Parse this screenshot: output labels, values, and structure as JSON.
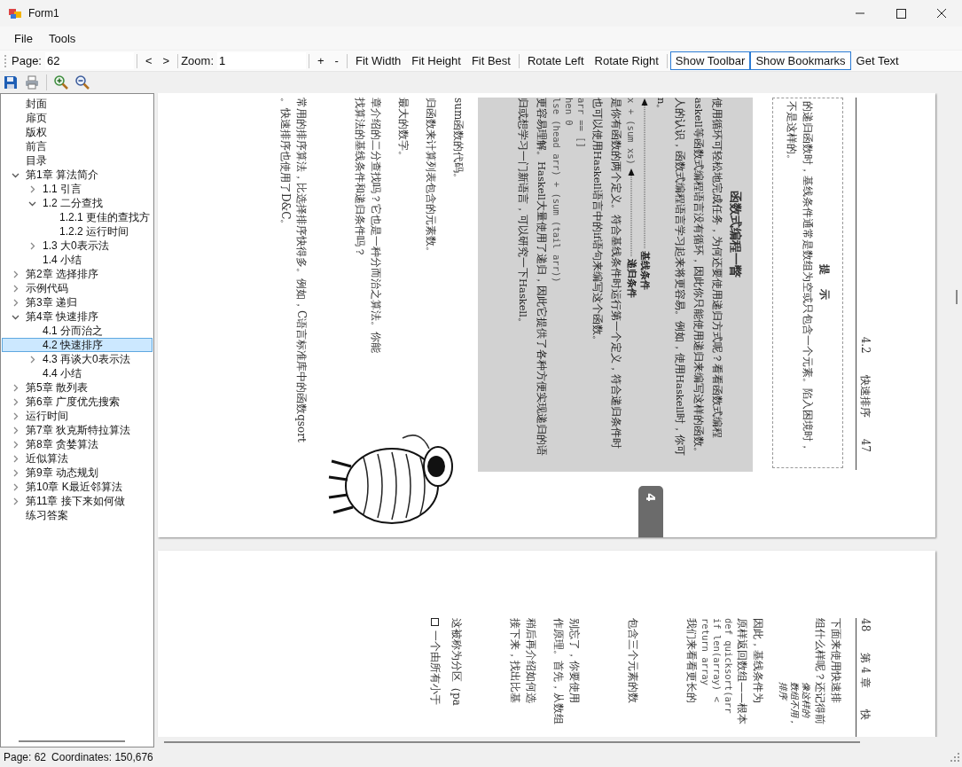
{
  "window": {
    "title": "Form1"
  },
  "menu": [
    "File",
    "Tools"
  ],
  "toolbar": {
    "groups": [
      [
        {
          "kind": "label",
          "text": "Page:"
        },
        {
          "kind": "field",
          "value": "62"
        }
      ],
      [
        {
          "kind": "button",
          "text": "<"
        },
        {
          "kind": "button",
          "text": ">"
        }
      ],
      [
        {
          "kind": "label",
          "text": "Zoom:"
        },
        {
          "kind": "field",
          "value": "1"
        }
      ],
      [
        {
          "kind": "button",
          "text": "+"
        },
        {
          "kind": "button",
          "text": "-"
        }
      ],
      [
        {
          "kind": "button",
          "text": "Fit Width"
        },
        {
          "kind": "button",
          "text": "Fit Height"
        },
        {
          "kind": "button",
          "text": "Fit Best"
        }
      ],
      [
        {
          "kind": "button",
          "text": "Rotate Left"
        },
        {
          "kind": "button",
          "text": "Rotate Right"
        }
      ],
      [
        {
          "kind": "toggle",
          "text": "Show Toolbar",
          "checked": true
        },
        {
          "kind": "toggle",
          "text": "Show Bookmarks",
          "checked": true
        },
        {
          "kind": "button",
          "text": "Get Text"
        }
      ]
    ]
  },
  "sidebar": {
    "items": [
      {
        "label": "封面",
        "selected": false
      },
      {
        "label": "扉页",
        "selected": false
      },
      {
        "label": "版权",
        "selected": false
      },
      {
        "label": "前言",
        "selected": false
      },
      {
        "label": "目录",
        "selected": false
      },
      {
        "label": "第1章 算法简介",
        "selected": false,
        "expanded": true,
        "children": [
          {
            "label": "1.1 引言",
            "selected": false,
            "expanded": false
          },
          {
            "label": "1.2 二分查找",
            "selected": false,
            "expanded": true,
            "children": [
              {
                "label": "1.2.1 更佳的查找方",
                "selected": false
              },
              {
                "label": "1.2.2 运行时间",
                "selected": false
              }
            ]
          },
          {
            "label": "1.3 大0表示法",
            "selected": false,
            "expanded": false
          },
          {
            "label": "1.4 小结",
            "selected": false
          }
        ]
      },
      {
        "label": "第2章 选择排序",
        "selected": false,
        "expanded": false
      },
      {
        "label": "示例代码",
        "selected": false,
        "expanded": false
      },
      {
        "label": "第3章 递归",
        "selected": false,
        "expanded": false
      },
      {
        "label": "第4章 快速排序",
        "selected": false,
        "expanded": true,
        "children": [
          {
            "label": "4.1 分而治之",
            "selected": false
          },
          {
            "label": "4.2 快速排序",
            "selected": true
          },
          {
            "label": "4.3 再谈大0表示法",
            "selected": false,
            "expanded": false
          },
          {
            "label": "4.4 小结",
            "selected": false
          }
        ]
      },
      {
        "label": "第5章 散列表",
        "selected": false,
        "expanded": false
      },
      {
        "label": "第6章 广度优先搜索",
        "selected": false,
        "expanded": false
      },
      {
        "label": "运行时间",
        "selected": false,
        "expanded": false
      },
      {
        "label": "第7章 狄克斯特拉算法",
        "selected": false,
        "expanded": false
      },
      {
        "label": "第8章 贪婪算法",
        "selected": false,
        "expanded": false
      },
      {
        "label": "近似算法",
        "selected": false,
        "expanded": false
      },
      {
        "label": "第9章 动态规划",
        "selected": false,
        "expanded": false
      },
      {
        "label": "第10章 K最近邻算法",
        "selected": false,
        "expanded": false
      },
      {
        "label": "第11章 接下来如何做",
        "selected": false,
        "expanded": false
      },
      {
        "label": "练习答案",
        "selected": false
      }
    ]
  },
  "pages": [
    {
      "thumb_tab": "4",
      "blocks": [
        {
          "kind": "recto",
          "parts": [
            "4.2",
            "快速排序",
            "47"
          ]
        },
        {
          "kind": "tip",
          "title": "提　示",
          "lines": [
            "的递归函数时，基线条件通常是数组为空或只包含一个元素。陷入困境时，",
            "不是这样的。"
          ]
        },
        {
          "kind": "box",
          "title": "函数式编程一瞥",
          "lines": [
            {
              "kind": "text",
              "text": "使用循环可轻松地完成任务，为何还要使用递归方式呢？看看函数式编程"
            },
            {
              "kind": "text",
              "text": "askell等函数式编程语言没有循环，因此你只能使用递归来编写这样的函数。"
            },
            {
              "kind": "text",
              "text": "人的认识，函数式编程语言学习起来将更容易。例如，使用Haskell时，你可"
            },
            {
              "kind": "text",
              "text": "n。"
            },
            {
              "kind": "callout",
              "callout": "基线条件"
            },
            {
              "kind": "callout",
              "text": "x + (sum xs)",
              "callout": "递归条件"
            },
            {
              "kind": "text",
              "text": "是你有函数的两个定义。符合基线条件时运行第一个定义，符合递归条件时"
            },
            {
              "kind": "text",
              "text": "也可以使用Haskell语言中的if语句来编写这个函数。"
            },
            {
              "kind": "code",
              "text": "arr == []"
            },
            {
              "kind": "code",
              "text": "hen 0"
            },
            {
              "kind": "code",
              "text": "lse (head arr) + (sum (tail arr))"
            },
            {
              "kind": "text",
              "text": "更容易理解。Haskell大量使用了递归，因此它提供了各种方便实现递归的语"
            },
            {
              "kind": "text",
              "text": "归或想学习一门新语言，可以研究一下Haskell。"
            }
          ]
        },
        {
          "kind": "figure"
        },
        {
          "kind": "para",
          "text": "sum函数的代码。"
        },
        {
          "kind": "para",
          "text": "归函数来计算列表包含的元素数。"
        },
        {
          "kind": "para",
          "text": "最大的数字。"
        },
        {
          "kind": "para",
          "text": "章介绍的二分查找吗？它也是一种分而治之算法。你能"
        },
        {
          "kind": "line",
          "text": "找算法的基线条件和递归条件吗？"
        },
        {
          "kind": "break",
          "text": "常用的排序算法，比选择排序快得多。例如，C语言标准库中的函数qsort"
        },
        {
          "kind": "line",
          "text": "。快速排序也使用了D&C。"
        }
      ]
    },
    {
      "blocks": [
        {
          "kind": "verso",
          "parts": [
            "48",
            "第 4 章",
            "快"
          ]
        },
        {
          "kind": "para",
          "text": "下面来使用快速排"
        },
        {
          "kind": "line",
          "text": "组什么样呢？还记得前"
        },
        {
          "kind": "note",
          "text": "像这样的"
        },
        {
          "kind": "note",
          "text": "数组不用，"
        },
        {
          "kind": "note",
          "text": "排序"
        },
        {
          "kind": "para",
          "text": "因此，基线条件为"
        },
        {
          "kind": "line",
          "text": "原样返回数组——根本"
        },
        {
          "kind": "code",
          "text": "def quicksort(arr"
        },
        {
          "kind": "code",
          "text": "if len(array) <"
        },
        {
          "kind": "code",
          "text": "return array"
        },
        {
          "kind": "line",
          "text": "我们来看看更长的"
        },
        {
          "kind": "break",
          "text": "包含三个元素的数"
        },
        {
          "kind": "break",
          "text": "别忘了，你要使用"
        },
        {
          "kind": "line",
          "text": "作原理。首先，从数组"
        },
        {
          "kind": "para",
          "text": "稍后再介绍如何选"
        },
        {
          "kind": "line",
          "text": "接下来，找出比基"
        },
        {
          "kind": "break",
          "text": "这被称为分区（pa"
        },
        {
          "kind": "bullet",
          "text": "一个由所有小于"
        }
      ]
    }
  ],
  "status_bar": [
    "Page: 62",
    "Coordinates: 150,676"
  ]
}
